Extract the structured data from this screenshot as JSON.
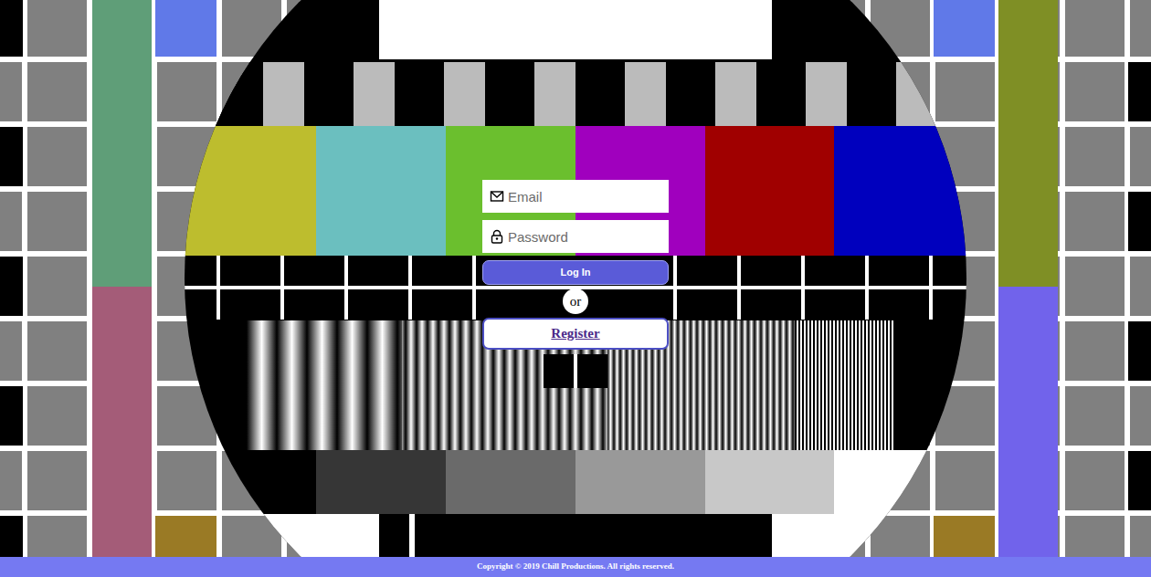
{
  "login_form": {
    "email": {
      "placeholder": "Email"
    },
    "password": {
      "placeholder": "Password"
    },
    "submit": "Log In",
    "separator": "or",
    "register": "Register"
  },
  "footer": {
    "copyright": "Copyright © 2019 Chill Productions. All rights reserved."
  }
}
